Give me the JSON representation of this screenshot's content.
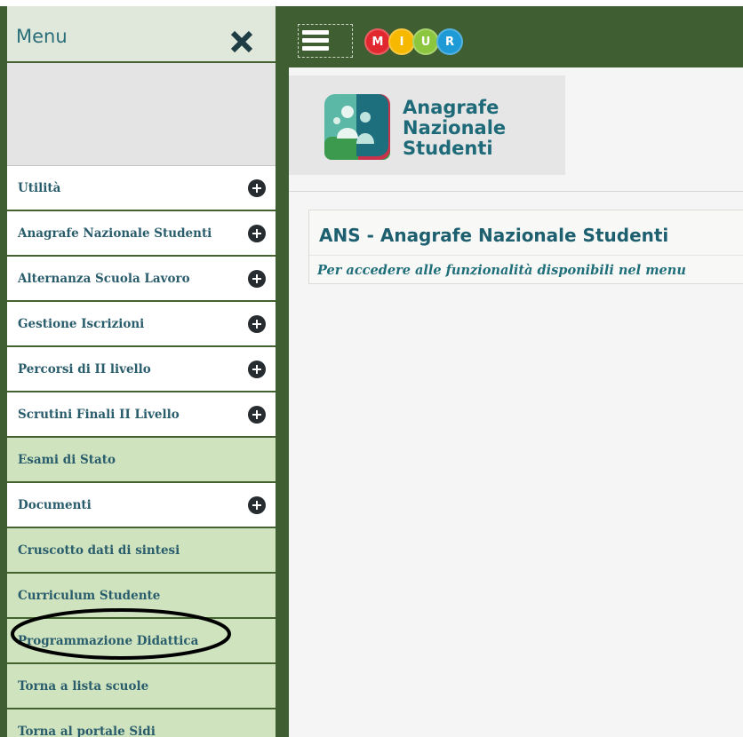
{
  "sidebar": {
    "title": "Menu",
    "close_icon": "close-x-icon",
    "items": [
      {
        "label": "Utilità",
        "expandable": true
      },
      {
        "label": "Anagrafe Nazionale Studenti",
        "expandable": true
      },
      {
        "label": "Alternanza Scuola Lavoro",
        "expandable": true
      },
      {
        "label": "Gestione Iscrizioni",
        "expandable": true
      },
      {
        "label": "Percorsi di II livello",
        "expandable": true
      },
      {
        "label": "Scrutini Finali II Livello",
        "expandable": true
      },
      {
        "label": "Esami di Stato",
        "expandable": false
      },
      {
        "label": "Documenti",
        "expandable": true
      },
      {
        "label": "Cruscotto dati di sintesi",
        "expandable": false
      },
      {
        "label": "Curriculum Studente",
        "expandable": false
      },
      {
        "label": "Programmazione Didattica",
        "expandable": false
      },
      {
        "label": "Torna a lista scuole",
        "expandable": false
      },
      {
        "label": "Torna al portale Sidi",
        "expandable": false
      }
    ]
  },
  "header": {
    "hamburger_icon": "hamburger-menu-icon",
    "logo_letters": [
      "M",
      "I",
      "U",
      "R"
    ],
    "logo_colors": [
      "#e2282f",
      "#f7b800",
      "#8cc63f",
      "#1e9ad6"
    ]
  },
  "brand": {
    "lines": [
      "Anagrafe",
      "Nazionale",
      "Studenti"
    ],
    "icon": "students-group-icon"
  },
  "main": {
    "title": "ANS - Anagrafe Nazionale Studenti",
    "subtitle": "Per accedere alle funzionalità disponibili nel menu"
  },
  "colors": {
    "header_green": "#3f5e32",
    "menu_green": "#cfe3bf",
    "text_teal": "#1e5f6f",
    "annotation": "#000000"
  }
}
